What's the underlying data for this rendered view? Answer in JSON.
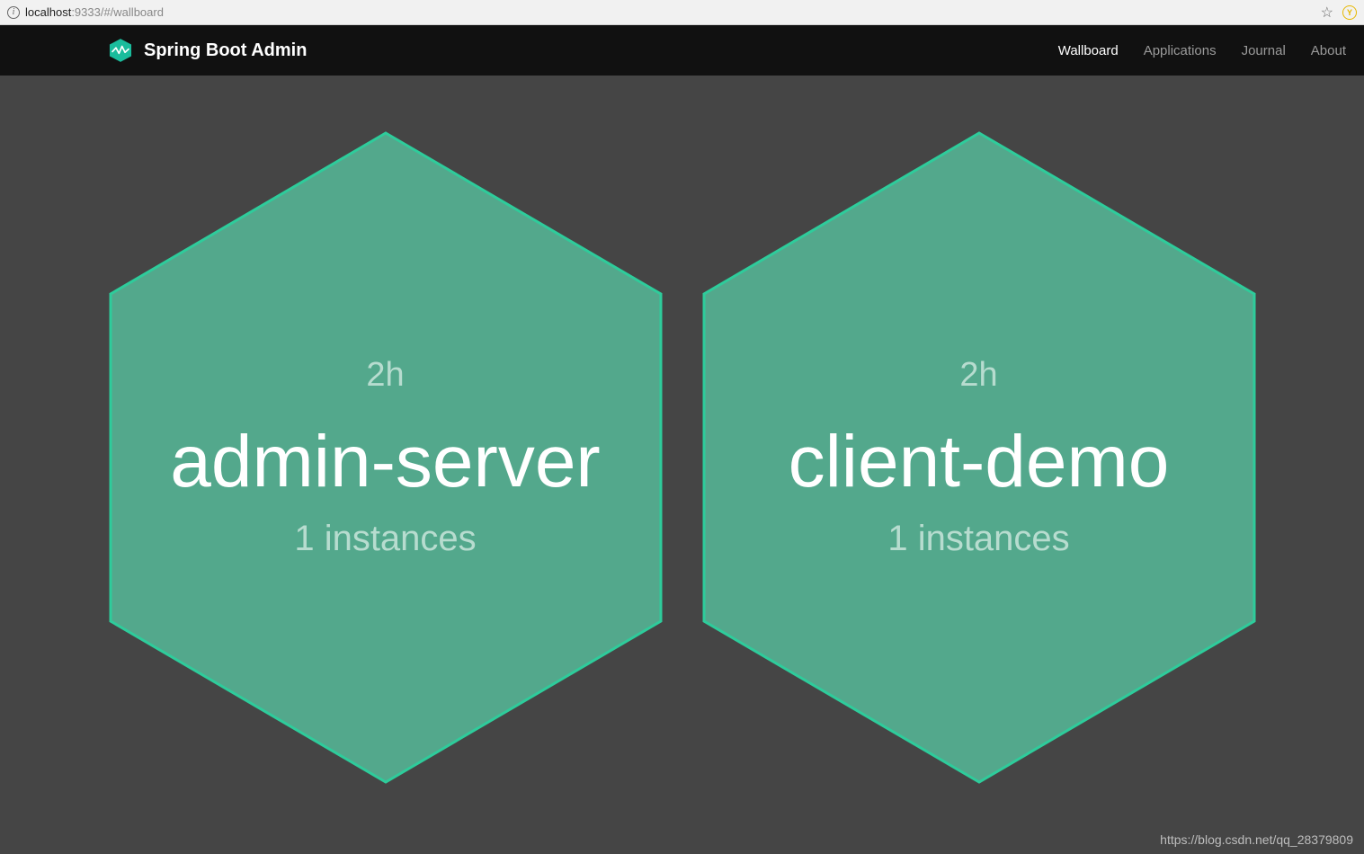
{
  "browser": {
    "url_host": "localhost",
    "url_rest": ":9333/#/wallboard",
    "info_glyph": "i"
  },
  "navbar": {
    "brand": "Spring Boot Admin",
    "links": [
      {
        "label": "Wallboard",
        "active": true
      },
      {
        "label": "Applications",
        "active": false
      },
      {
        "label": "Journal",
        "active": false
      },
      {
        "label": "About",
        "active": false
      }
    ]
  },
  "hex_fill": "#53A88C",
  "hex_stroke": "#2ECC9B",
  "apps": [
    {
      "uptime": "2h",
      "name": "admin-server",
      "instances": "1 instances"
    },
    {
      "uptime": "2h",
      "name": "client-demo",
      "instances": "1 instances"
    }
  ],
  "watermark": "https://blog.csdn.net/qq_28379809"
}
